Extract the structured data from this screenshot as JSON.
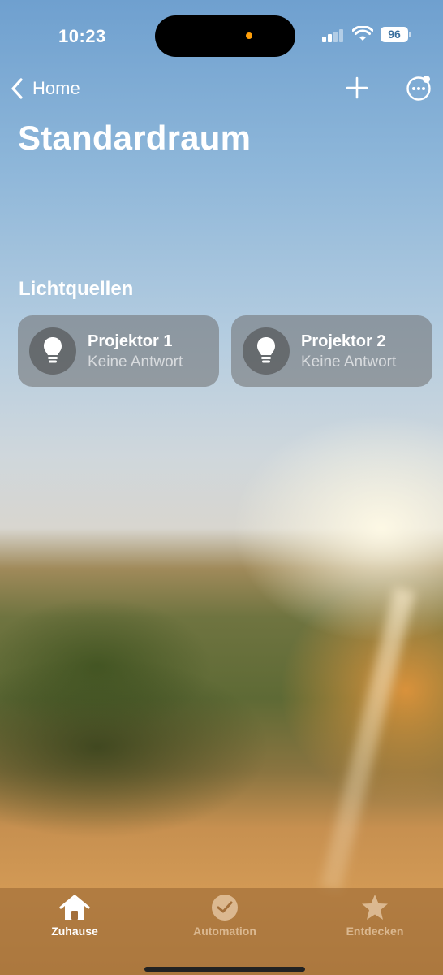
{
  "status_bar": {
    "time": "10:23",
    "battery": "96"
  },
  "nav": {
    "back_label": "Home"
  },
  "page": {
    "title": "Standardraum"
  },
  "section": {
    "title": "Lichtquellen"
  },
  "accessories": [
    {
      "name": "Projektor 1",
      "status": "Keine Antwort",
      "icon": "lightbulb-icon"
    },
    {
      "name": "Projektor 2",
      "status": "Keine Antwort",
      "icon": "lightbulb-icon"
    }
  ],
  "tabs": [
    {
      "label": "Zuhause",
      "icon": "house-icon",
      "selected": true
    },
    {
      "label": "Automation",
      "icon": "clock-icon",
      "selected": false
    },
    {
      "label": "Entdecken",
      "icon": "star-icon",
      "selected": false
    }
  ],
  "colors": {
    "recording_dot": "#ff9f0a",
    "battery_text": "#3a6f9e"
  }
}
